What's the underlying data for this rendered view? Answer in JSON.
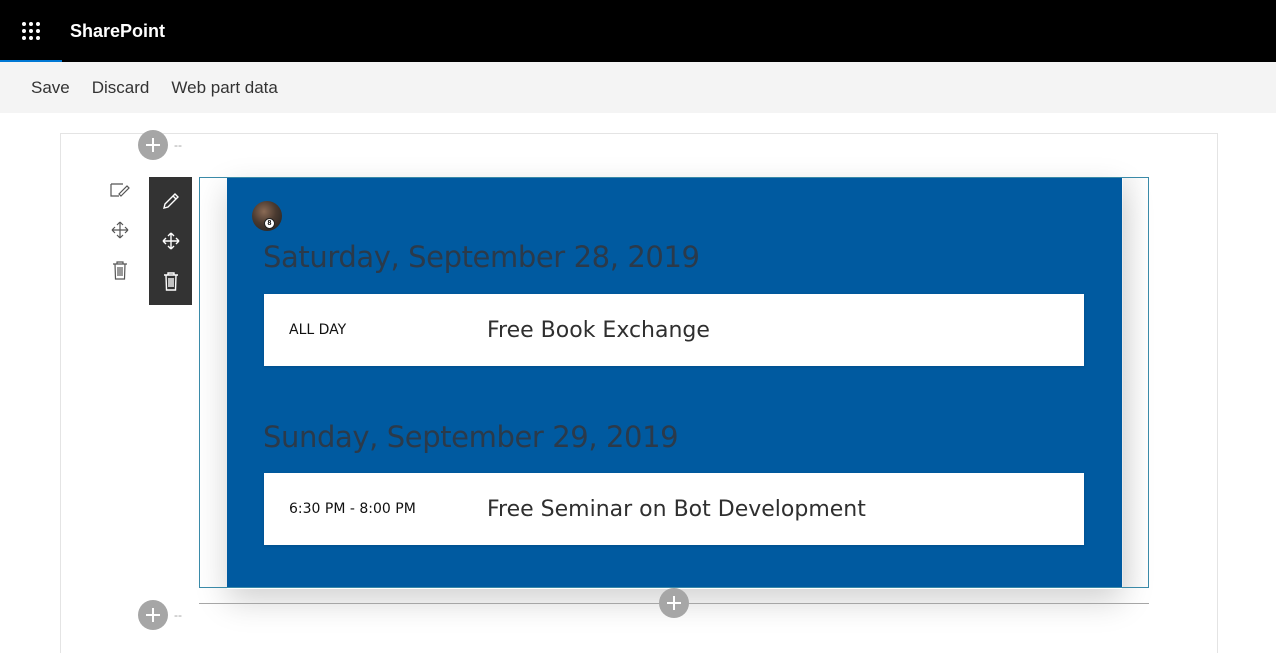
{
  "suitebar": {
    "app_name": "SharePoint",
    "waffle_icon": "waffle-icon"
  },
  "commandbar": {
    "save_label": "Save",
    "discard_label": "Discard",
    "web_part_data_label": "Web part data"
  },
  "section_tools": {
    "icons": [
      "edit-section-icon",
      "move-icon",
      "delete-icon"
    ]
  },
  "webpart_toolbar": {
    "icons": [
      "pencil-icon",
      "move-icon",
      "delete-icon"
    ]
  },
  "events": {
    "background_color": "#005aa0",
    "days": [
      {
        "date": "Saturday, September 28, 2019",
        "items": [
          {
            "time": "ALL DAY",
            "title": "Free Book Exchange"
          }
        ]
      },
      {
        "date": "Sunday, September 29, 2019",
        "items": [
          {
            "time": "6:30 PM - 8:00 PM",
            "title": "Free Seminar on Bot Development"
          }
        ]
      }
    ]
  },
  "add_controls": {
    "icon": "add-icon",
    "dash_text": "--"
  }
}
